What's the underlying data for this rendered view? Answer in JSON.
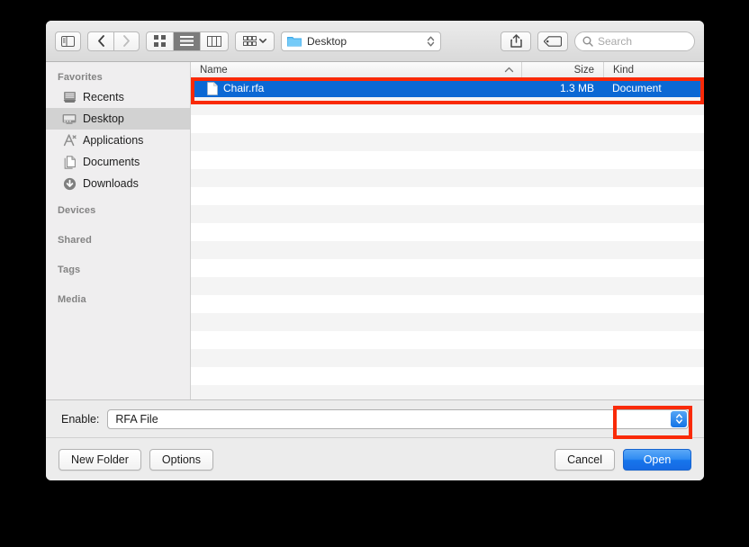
{
  "window": {
    "title": "Open file dialog"
  },
  "toolbar": {
    "sidebar_toggle_icon": "sidebar-toggle-icon",
    "back_icon": "chevron-left-icon",
    "forward_icon": "chevron-right-icon",
    "view_modes": [
      {
        "name": "icon-view",
        "icon": "grid-icon",
        "active": false
      },
      {
        "name": "list-view",
        "icon": "list-icon",
        "active": true
      },
      {
        "name": "column-view",
        "icon": "columns-icon",
        "active": false
      }
    ],
    "arrange_icon": "arrange-grid-icon",
    "arrange_chevron_icon": "chevron-down-icon",
    "path_popup": {
      "icon": "folder-icon",
      "label": "Desktop",
      "stepper_icon": "up-down-stepper-icon"
    },
    "share_icon": "share-icon",
    "tag_icon": "tag-icon",
    "search": {
      "icon": "search-icon",
      "placeholder": "Search",
      "value": ""
    }
  },
  "sidebar": {
    "sections": [
      {
        "header": "Favorites",
        "items": [
          {
            "label": "Recents",
            "icon": "recents-icon",
            "selected": false
          },
          {
            "label": "Desktop",
            "icon": "desktop-icon",
            "selected": true
          },
          {
            "label": "Applications",
            "icon": "applications-icon",
            "selected": false
          },
          {
            "label": "Documents",
            "icon": "documents-icon",
            "selected": false
          },
          {
            "label": "Downloads",
            "icon": "downloads-icon",
            "selected": false
          }
        ]
      },
      {
        "header": "Devices",
        "items": []
      },
      {
        "header": "Shared",
        "items": []
      },
      {
        "header": "Tags",
        "items": []
      },
      {
        "header": "Media",
        "items": []
      }
    ]
  },
  "file_list": {
    "columns": {
      "name": "Name",
      "size": "Size",
      "kind": "Kind",
      "sort_caret": "⌃"
    },
    "rows": [
      {
        "name": "Chair.rfa",
        "size": "1.3 MB",
        "kind": "Document",
        "icon": "document-file-icon",
        "selected": true
      }
    ],
    "empty_row_count": 17
  },
  "enable_bar": {
    "label": "Enable:",
    "value": "RFA File",
    "stepper_icon": "up-down-stepper-icon"
  },
  "bottom_bar": {
    "new_folder_label": "New Folder",
    "options_label": "Options",
    "cancel_label": "Cancel",
    "open_label": "Open"
  },
  "annotations": [
    {
      "name": "selected-file-highlight",
      "target": "Chair.rfa row"
    },
    {
      "name": "open-button-highlight",
      "target": "Open button"
    }
  ],
  "colors": {
    "selection_blue": "#0b68d4",
    "annotation_red": "#f92a07",
    "primary_button_blue": "#1776ec",
    "window_chrome": "#ececec",
    "sidebar_bg": "#efeeef"
  }
}
